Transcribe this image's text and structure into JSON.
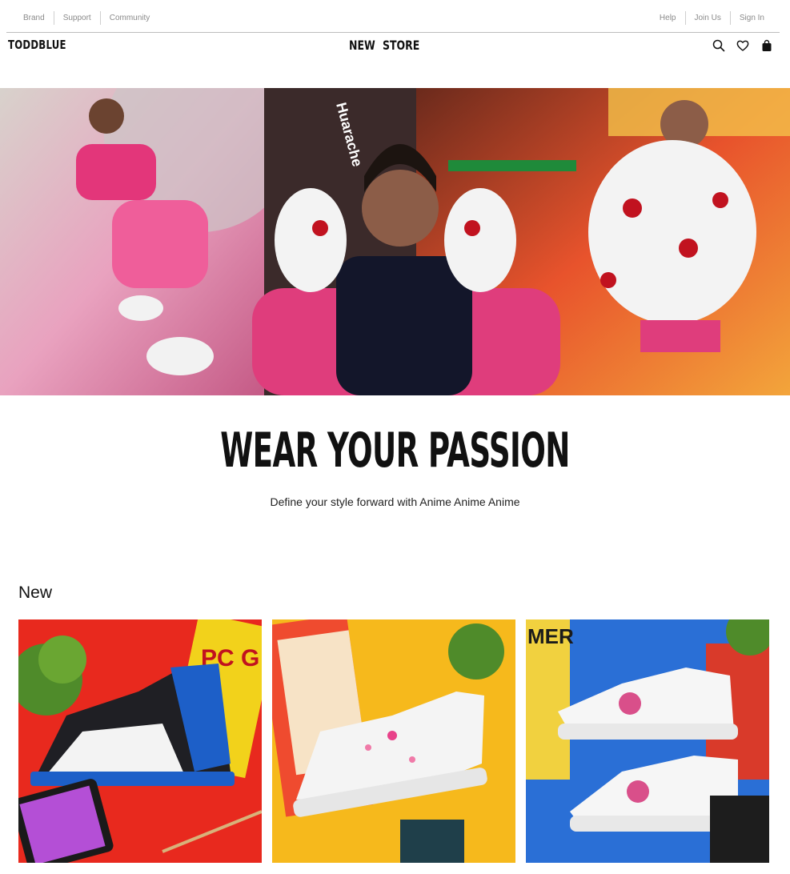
{
  "utility_nav": {
    "left_links": [
      "Brand",
      "Support",
      "Community"
    ],
    "right_links": [
      "Help",
      "Join Us",
      "Sign In"
    ]
  },
  "header": {
    "logo": "TODDBLUE",
    "nav_links": [
      "NEW",
      "STORE"
    ],
    "icons": [
      "search-icon",
      "heart-icon",
      "bag-icon"
    ]
  },
  "hero": {
    "image_text": "Huarache",
    "headline": "WEAR YOUR PASSION",
    "subheadline": "Define your style forward with Anime Anime Anime"
  },
  "section": {
    "title": "New"
  },
  "products": [
    {
      "image_alt": "Anime custom high-top sneaker",
      "magazine_text": "PC G"
    },
    {
      "image_alt": "Cherry blossom custom white sneaker",
      "magazine_text": ""
    },
    {
      "image_alt": "Anime custom white sneakers pair",
      "magazine_text": "MER"
    }
  ],
  "colors": {
    "text": "#111111",
    "muted": "#8a8a8a",
    "divider": "#bdbdbd",
    "hero_pink": "#e0457e",
    "card1_bg": "#e8291e",
    "card2_bg": "#f6b91c",
    "card3_bg": "#2a6fd6"
  }
}
